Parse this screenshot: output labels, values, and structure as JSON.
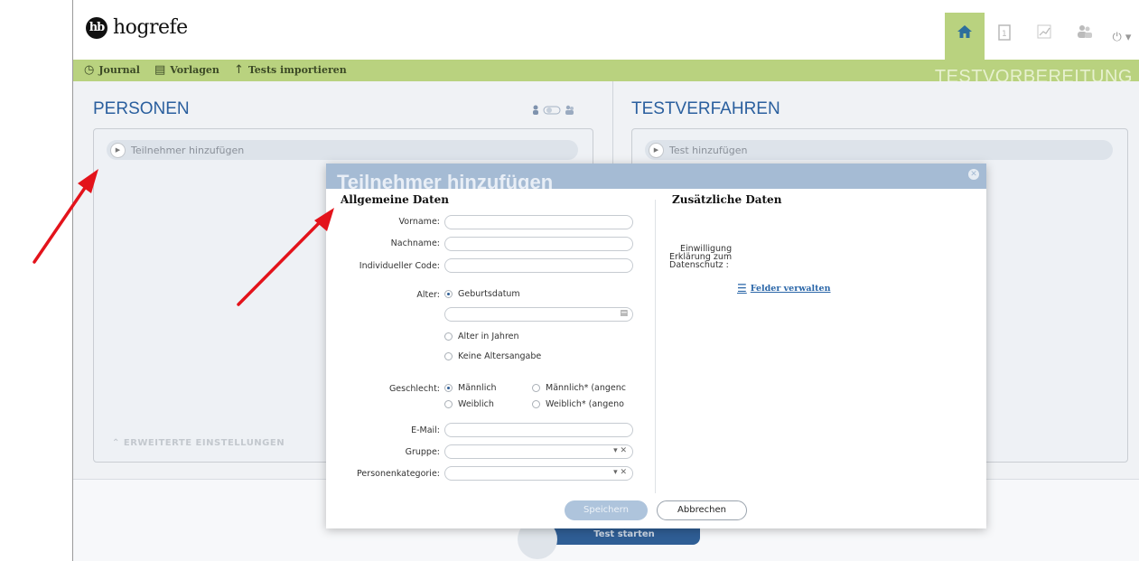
{
  "logo": {
    "mark": "hb",
    "text": "hogrefe"
  },
  "topbar": {
    "power_glyph": "⏻ ▾"
  },
  "nav": {
    "items": [
      {
        "icon": "◷",
        "label": "Journal"
      },
      {
        "icon": "▤",
        "label": "Vorlagen"
      },
      {
        "icon": "↑",
        "label": "Tests importieren"
      }
    ]
  },
  "section_title": "TESTVORBEREITUNG",
  "left": {
    "title": "PERSONEN",
    "add_label": "Teilnehmer hinzufügen",
    "advanced": "ERWEITERTE EINSTELLUNGEN"
  },
  "right": {
    "title": "TESTVERFAHREN",
    "add_label": "Test hinzufügen"
  },
  "start": {
    "label": "Test starten"
  },
  "modal": {
    "title": "Teilnehmer hinzufügen",
    "general_title": "Allgemeine Daten",
    "extra_title": "Zusätzliche Daten",
    "labels": {
      "firstname": "Vorname:",
      "lastname": "Nachname:",
      "code": "Individueller Code:",
      "age": "Alter:",
      "gender": "Geschlecht:",
      "email": "E-Mail:",
      "group": "Gruppe:",
      "category": "Personenkategorie:"
    },
    "values": {
      "firstname": "",
      "lastname": "",
      "code": "",
      "birthdate": "",
      "email": "",
      "group": "",
      "category": ""
    },
    "age_options": [
      "Geburtsdatum",
      "Alter in Jahren",
      "Keine Altersangabe"
    ],
    "gender_options": [
      "Männlich",
      "Weiblich",
      "Männlich* (angenc",
      "Weiblich* (angeno"
    ],
    "consent_lines": [
      "Einwilligung",
      "Erklärung zum",
      "Datenschutz :"
    ],
    "fields_link": "Felder verwalten",
    "save": "Speichern",
    "cancel": "Abbrechen",
    "select_glyphs": "▾ ✕",
    "close_glyph": "✕"
  },
  "colors": {
    "accent_green": "#b9d27f",
    "accent_blue": "#2a5f9e",
    "annotation_red": "#e3131b"
  }
}
